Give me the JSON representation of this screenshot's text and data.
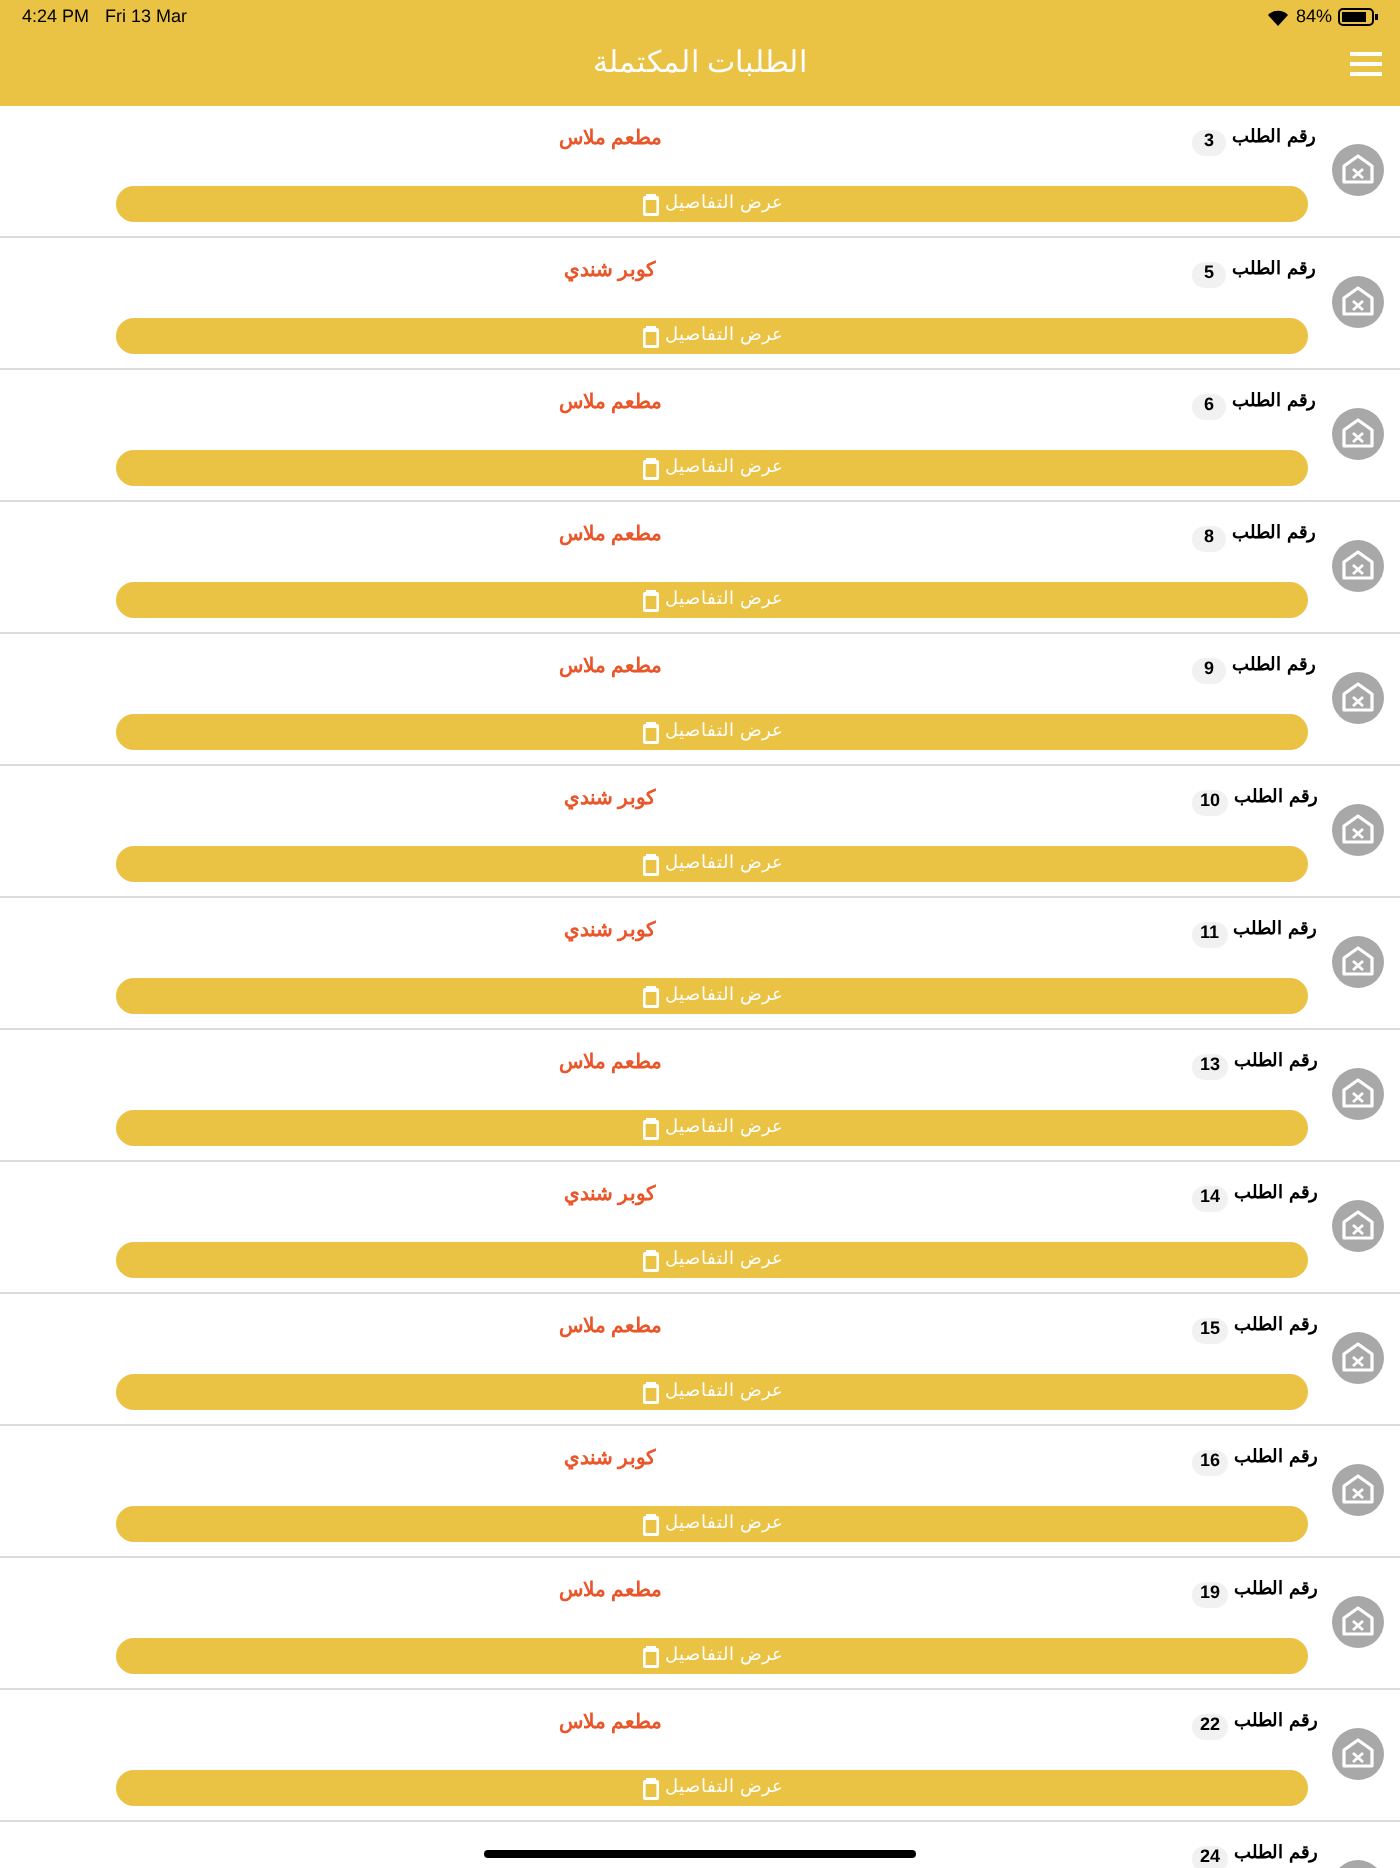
{
  "status_bar": {
    "time": "4:24 PM",
    "date": "Fri 13 Mar",
    "battery": "84%"
  },
  "header": {
    "title": "الطلبات المكتملة"
  },
  "orders": [
    {
      "label": "رقم الطلب",
      "number": "3",
      "restaurant": "مطعم ملاس",
      "button": "عرض التفاصيل"
    },
    {
      "label": "رقم الطلب",
      "number": "5",
      "restaurant": "كوبر شندي",
      "button": "عرض التفاصيل"
    },
    {
      "label": "رقم الطلب",
      "number": "6",
      "restaurant": "مطعم ملاس",
      "button": "عرض التفاصيل"
    },
    {
      "label": "رقم الطلب",
      "number": "8",
      "restaurant": "مطعم ملاس",
      "button": "عرض التفاصيل"
    },
    {
      "label": "رقم الطلب",
      "number": "9",
      "restaurant": "مطعم ملاس",
      "button": "عرض التفاصيل"
    },
    {
      "label": "رقم الطلب",
      "number": "10",
      "restaurant": "كوبر شندي",
      "button": "عرض التفاصيل"
    },
    {
      "label": "رقم الطلب",
      "number": "11",
      "restaurant": "كوبر شندي",
      "button": "عرض التفاصيل"
    },
    {
      "label": "رقم الطلب",
      "number": "13",
      "restaurant": "مطعم ملاس",
      "button": "عرض التفاصيل"
    },
    {
      "label": "رقم الطلب",
      "number": "14",
      "restaurant": "كوبر شندي",
      "button": "عرض التفاصيل"
    },
    {
      "label": "رقم الطلب",
      "number": "15",
      "restaurant": "مطعم ملاس",
      "button": "عرض التفاصيل"
    },
    {
      "label": "رقم الطلب",
      "number": "16",
      "restaurant": "كوبر شندي",
      "button": "عرض التفاصيل"
    },
    {
      "label": "رقم الطلب",
      "number": "19",
      "restaurant": "مطعم ملاس",
      "button": "عرض التفاصيل"
    },
    {
      "label": "رقم الطلب",
      "number": "22",
      "restaurant": "مطعم ملاس",
      "button": "عرض التفاصيل"
    },
    {
      "label": "رقم الطلب",
      "number": "24"
    }
  ]
}
